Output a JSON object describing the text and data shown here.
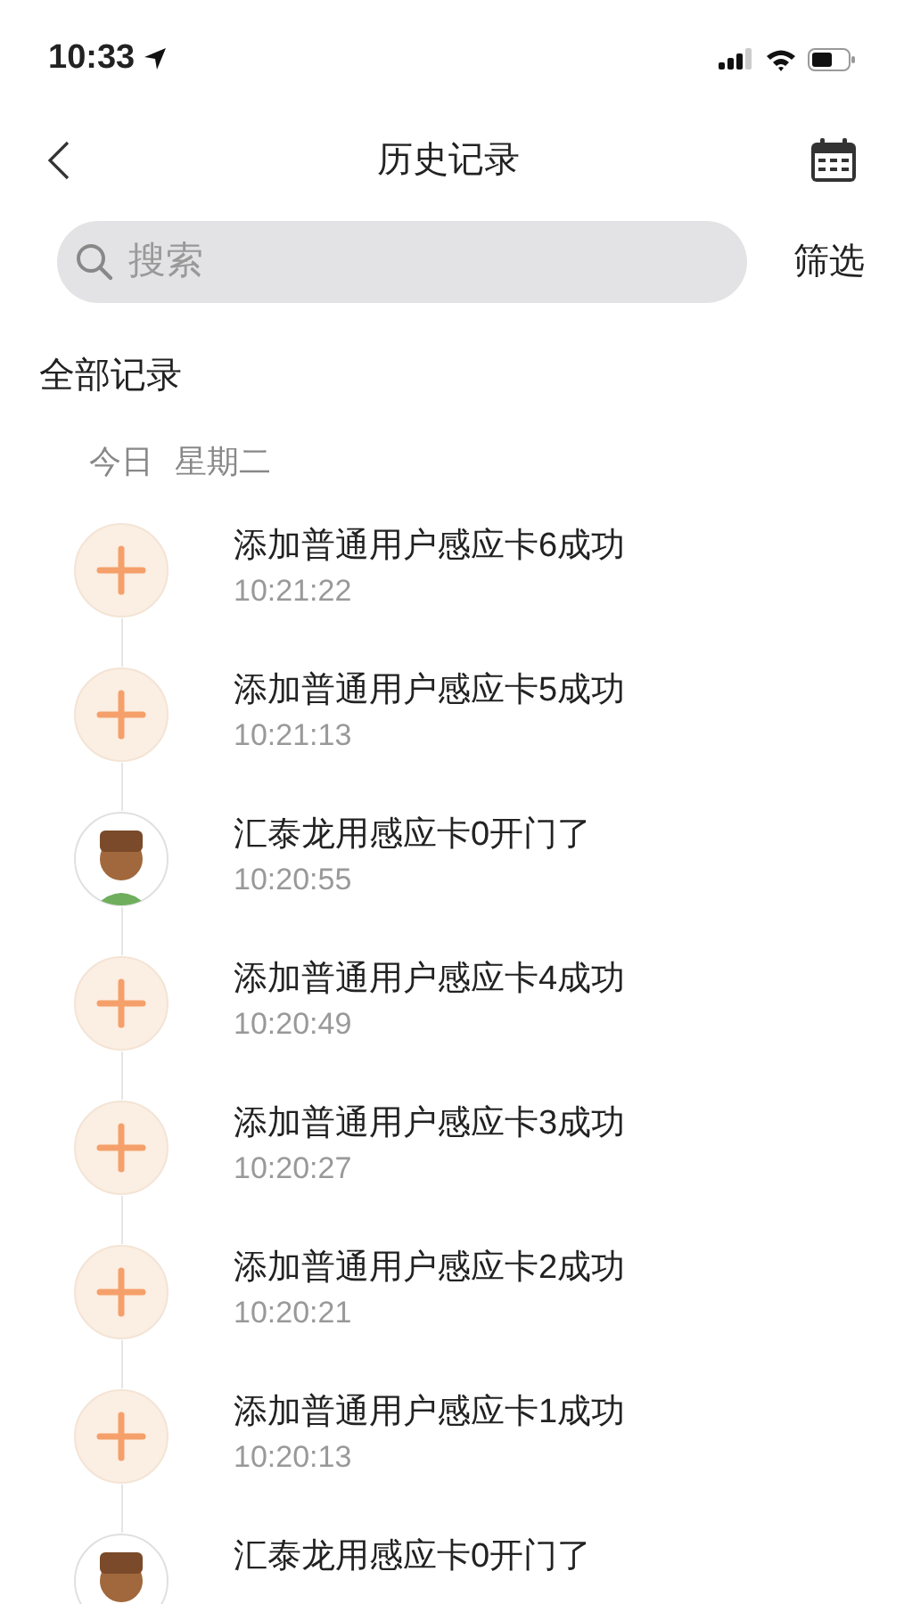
{
  "status_bar": {
    "time": "10:33"
  },
  "header": {
    "title": "历史记录"
  },
  "search": {
    "placeholder": "搜索"
  },
  "filter_button": "筛选",
  "section_title": "全部记录",
  "date_group": {
    "day": "今日",
    "weekday": "星期二"
  },
  "records": [
    {
      "kind": "add",
      "title": "添加普通用户感应卡6成功",
      "time": "10:21:22"
    },
    {
      "kind": "add",
      "title": "添加普通用户感应卡5成功",
      "time": "10:21:13"
    },
    {
      "kind": "avatar",
      "title": "汇泰龙用感应卡0开门了",
      "time": "10:20:55"
    },
    {
      "kind": "add",
      "title": "添加普通用户感应卡4成功",
      "time": "10:20:49"
    },
    {
      "kind": "add",
      "title": "添加普通用户感应卡3成功",
      "time": "10:20:27"
    },
    {
      "kind": "add",
      "title": "添加普通用户感应卡2成功",
      "time": "10:20:21"
    },
    {
      "kind": "add",
      "title": "添加普通用户感应卡1成功",
      "time": "10:20:13"
    },
    {
      "kind": "avatar",
      "title": "汇泰龙用感应卡0开门了"
    }
  ]
}
